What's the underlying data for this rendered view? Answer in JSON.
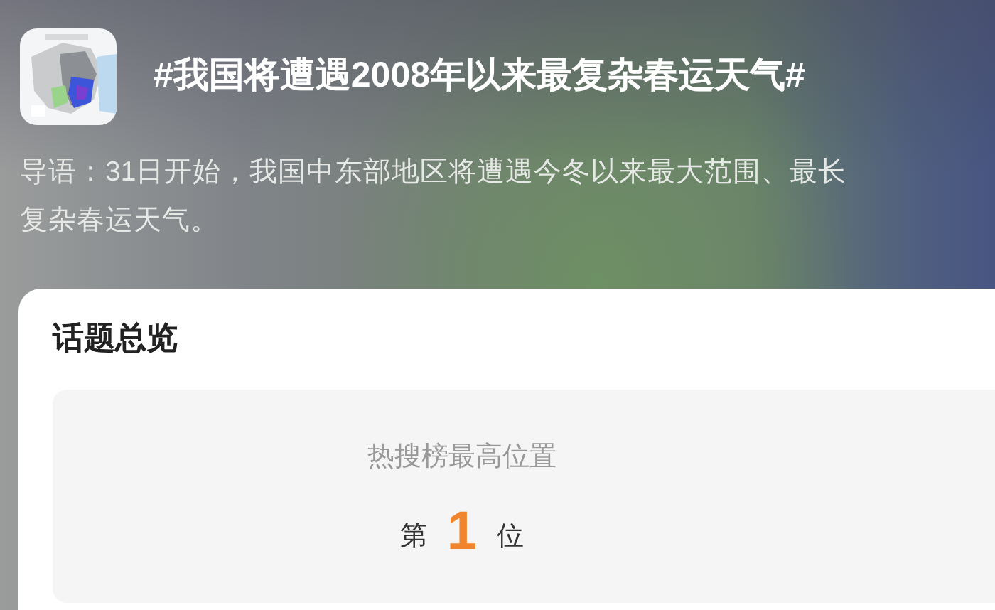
{
  "header": {
    "title": "#我国将遭遇2008年以来最复杂春运天气#"
  },
  "intro": {
    "lines": [
      "导语：31日开始，我国中东部地区将遭遇今冬以来最大范围、最长",
      "复杂春运天气。"
    ]
  },
  "overview": {
    "title": "话题总览",
    "stats": [
      {
        "label": "热搜榜最高位置",
        "prefix": "第",
        "value": "1",
        "suffix": "位"
      }
    ]
  }
}
